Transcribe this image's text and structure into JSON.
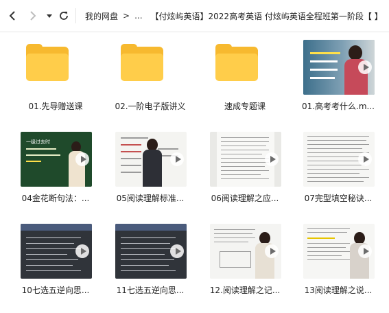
{
  "nav": {
    "back_icon": "chevron-left-icon",
    "forward_icon": "chevron-right-icon",
    "history_icon": "dropdown-triangle-icon",
    "refresh_icon": "refresh-icon"
  },
  "breadcrumb": {
    "root": "我的网盘",
    "sep": ">",
    "ellipsis": "...",
    "current": "【付炫屿英语】2022高考英语 付炫屿英语全程班第一阶段【 】"
  },
  "items": [
    {
      "type": "folder",
      "label": "01.先导赠送课"
    },
    {
      "type": "folder",
      "label": "02.一阶电子版讲义"
    },
    {
      "type": "folder",
      "label": "速成专题课"
    },
    {
      "type": "video",
      "label": "01.高考考什么.m..."
    },
    {
      "type": "video",
      "label": "04金花断句法：..."
    },
    {
      "type": "video",
      "label": "05阅读理解标准..."
    },
    {
      "type": "video",
      "label": "06阅读理解之应..."
    },
    {
      "type": "video",
      "label": "07完型填空秘诀..."
    },
    {
      "type": "video",
      "label": "10七选五逆向思..."
    },
    {
      "type": "video",
      "label": "11七选五逆向思..."
    },
    {
      "type": "video",
      "label": "12.阅读理解之记..."
    },
    {
      "type": "video",
      "label": "13阅读理解之说..."
    }
  ],
  "thumb_text": {
    "t4_title": "一级过去时"
  },
  "colors": {
    "folder_back": "#f7b92f",
    "folder_front": "#ffcd4a",
    "chalkboard": "#1f4a2b"
  }
}
